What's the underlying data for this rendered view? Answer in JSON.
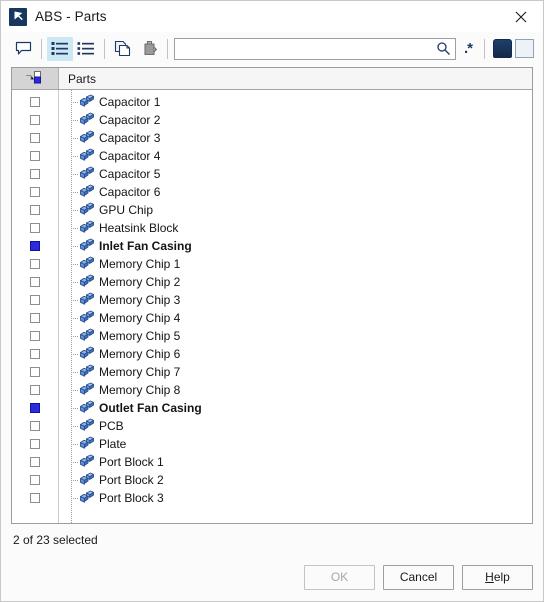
{
  "window": {
    "title": "ABS - Parts",
    "app_icon": "abaqus-cae-icon",
    "close_label": "✕"
  },
  "toolbar": {
    "buttons": [
      {
        "name": "annotation-balloon-icon",
        "tooltip": "Annotation",
        "active": false
      },
      {
        "name": "list-details-icon",
        "tooltip": "Details view",
        "active": true
      },
      {
        "name": "list-simple-icon",
        "tooltip": "List view",
        "active": false
      },
      {
        "name": "copy-icon",
        "tooltip": "Copy",
        "active": false
      },
      {
        "name": "paste-icon",
        "tooltip": "Paste",
        "active": false
      }
    ],
    "search": {
      "value": "",
      "placeholder": ""
    },
    "search_icon": "magnifier-icon",
    "regex_label": ".*",
    "swatch_dark": "#1c3a63",
    "swatch_light": "#eef1f6"
  },
  "list": {
    "header": {
      "check_icon": "tree-node-icon",
      "name_label": "Parts"
    },
    "rows": [
      {
        "label": "Capacitor 1",
        "checked": false
      },
      {
        "label": "Capacitor 2",
        "checked": false
      },
      {
        "label": "Capacitor 3",
        "checked": false
      },
      {
        "label": "Capacitor 4",
        "checked": false
      },
      {
        "label": "Capacitor 5",
        "checked": false
      },
      {
        "label": "Capacitor 6",
        "checked": false
      },
      {
        "label": "GPU Chip",
        "checked": false
      },
      {
        "label": "Heatsink Block",
        "checked": false
      },
      {
        "label": "Inlet Fan Casing",
        "checked": true
      },
      {
        "label": "Memory Chip 1",
        "checked": false
      },
      {
        "label": "Memory Chip 2",
        "checked": false
      },
      {
        "label": "Memory Chip 3",
        "checked": false
      },
      {
        "label": "Memory Chip 4",
        "checked": false
      },
      {
        "label": "Memory Chip 5",
        "checked": false
      },
      {
        "label": "Memory Chip 6",
        "checked": false
      },
      {
        "label": "Memory Chip 7",
        "checked": false
      },
      {
        "label": "Memory Chip 8",
        "checked": false
      },
      {
        "label": "Outlet Fan Casing",
        "checked": true
      },
      {
        "label": "PCB",
        "checked": false
      },
      {
        "label": "Plate",
        "checked": false
      },
      {
        "label": "Port Block 1",
        "checked": false
      },
      {
        "label": "Port Block 2",
        "checked": false
      },
      {
        "label": "Port Block 3",
        "checked": false
      }
    ]
  },
  "status": {
    "text": "2 of 23 selected"
  },
  "footer": {
    "ok_label": "OK",
    "ok_disabled": true,
    "cancel_label": "Cancel",
    "help_label_before": "",
    "help_accel": "H",
    "help_label_after": "elp"
  }
}
